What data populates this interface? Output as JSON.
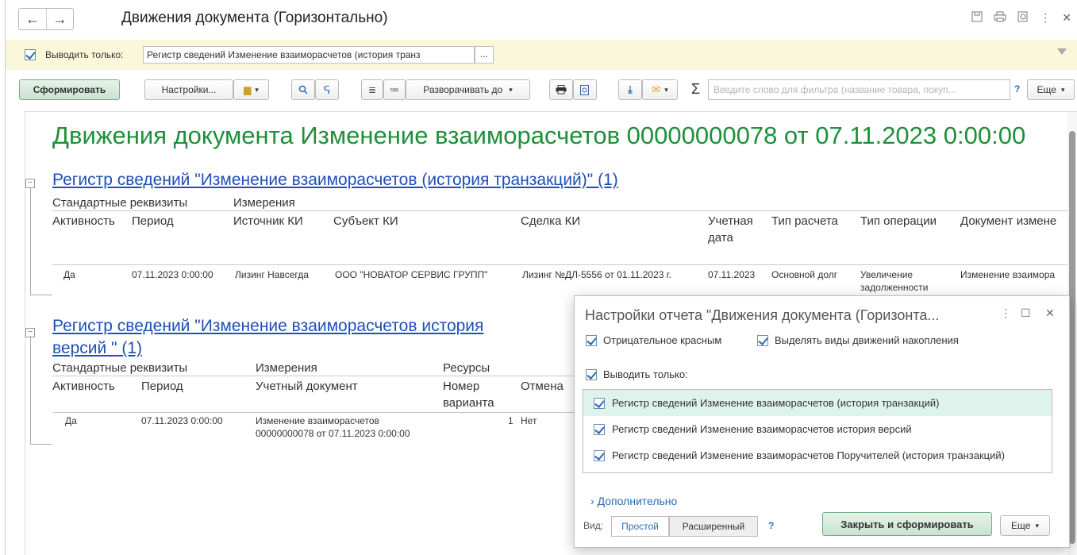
{
  "window": {
    "title": "Движения документа (Горизонтально)",
    "back_icon": "←",
    "forward_icon": "→",
    "icons": [
      "save-icon",
      "print-icon",
      "preview-icon",
      "more-icon",
      "close-icon"
    ]
  },
  "filter": {
    "checked": true,
    "label": "Выводить только:",
    "value": "Регистр сведений Изменение взаиморасчетов (история транз",
    "more": "..."
  },
  "toolbar": {
    "generate": "Сформировать",
    "settings": "Настройки...",
    "expand": "Разворачивать до",
    "search_placeholder": "Введите слово для фильтра (название товара, покуп...",
    "help": "?",
    "more": "Еще",
    "sigma": "Σ"
  },
  "report": {
    "title": "Движения документа Изменение взаиморасчетов 00000000078 от 07.11.2023 0:00:00",
    "reg1": {
      "title": "Регистр сведений \"Изменение взаиморасчетов (история транзакций)\" (1)",
      "group_std": "Стандартные реквизиты",
      "group_dim": "Измерения",
      "headers": [
        "Активность",
        "Период",
        "Источник КИ",
        "Субъект КИ",
        "Сделка КИ",
        "Учетная",
        "дата",
        "Тип расчета",
        "Тип операции",
        "Документ измене"
      ],
      "row": [
        "Да",
        "07.11.2023 0:00:00",
        "Лизинг Навсегда",
        "ООО \"НОВАТОР СЕРВИС ГРУПП\"",
        "Лизинг №ДЛ-5556 от 01.11.2023 г.",
        "07.11.2023",
        "Основной долг",
        "Увеличение",
        "задолженности",
        "Изменение взаимора"
      ]
    },
    "reg2": {
      "title_line1": "Регистр сведений \"Изменение взаиморасчетов история",
      "title_line2": "версий \" (1)",
      "group_std": "Стандартные реквизиты",
      "group_dim": "Измерения",
      "group_res": "Ресурсы",
      "headers": [
        "Активность",
        "Период",
        "Учетный документ",
        "Номер",
        "варианта",
        "Отмена"
      ],
      "row": [
        "Да",
        "07.11.2023 0:00:00",
        "Изменение взаиморасчетов",
        "00000000078 от 07.11.2023 0:00:00",
        "1",
        "Нет"
      ]
    }
  },
  "dialog": {
    "title": "Настройки отчета \"Движения документа (Горизонта...",
    "opt1": "Отрицательное красным",
    "opt2": "Выделять виды движений накопления",
    "only": "Выводить только:",
    "items": [
      "Регистр сведений Изменение взаиморасчетов (история транзакций)",
      "Регистр сведений Изменение взаиморасчетов история версий",
      "Регистр сведений Изменение взаиморасчетов Поручителей (история транзакций)"
    ],
    "advanced": "Дополнительно",
    "view_label": "Вид:",
    "view_simple": "Простой",
    "view_extended": "Расширенный",
    "help": "?",
    "close_generate": "Закрыть и сформировать",
    "more": "Еще"
  }
}
